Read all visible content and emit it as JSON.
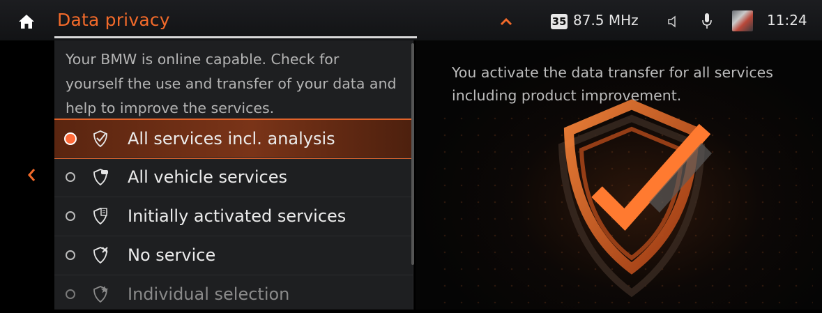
{
  "header": {
    "title": "Data privacy",
    "radio_preset": "35",
    "radio_frequency": "87.5 MHz",
    "clock": "11:24",
    "icons": [
      "home-icon",
      "chevron-up-icon",
      "speaker-icon",
      "microphone-icon",
      "avatar",
      "chevron-left-icon"
    ]
  },
  "intro_text": "Your BMW is online capable. Check for yourself the use and transfer of your data and help to improve the services.",
  "options": [
    {
      "label": "All services incl. analysis",
      "icon": "shield-check-icon",
      "selected": true
    },
    {
      "label": "All vehicle services",
      "icon": "shield-car-icon",
      "selected": false
    },
    {
      "label": "Initially activated services",
      "icon": "shield-document-icon",
      "selected": false
    },
    {
      "label": "No service",
      "icon": "shield-cross-icon",
      "selected": false
    },
    {
      "label": "Individual selection",
      "icon": "shield-star-icon",
      "selected": false
    }
  ],
  "description": "You activate the data transfer for all services including product improvement.",
  "colors": {
    "accent": "#f26a2a",
    "selected_bg": "#7a3418",
    "panel_bg": "#1e1f21",
    "background": "#000000"
  }
}
